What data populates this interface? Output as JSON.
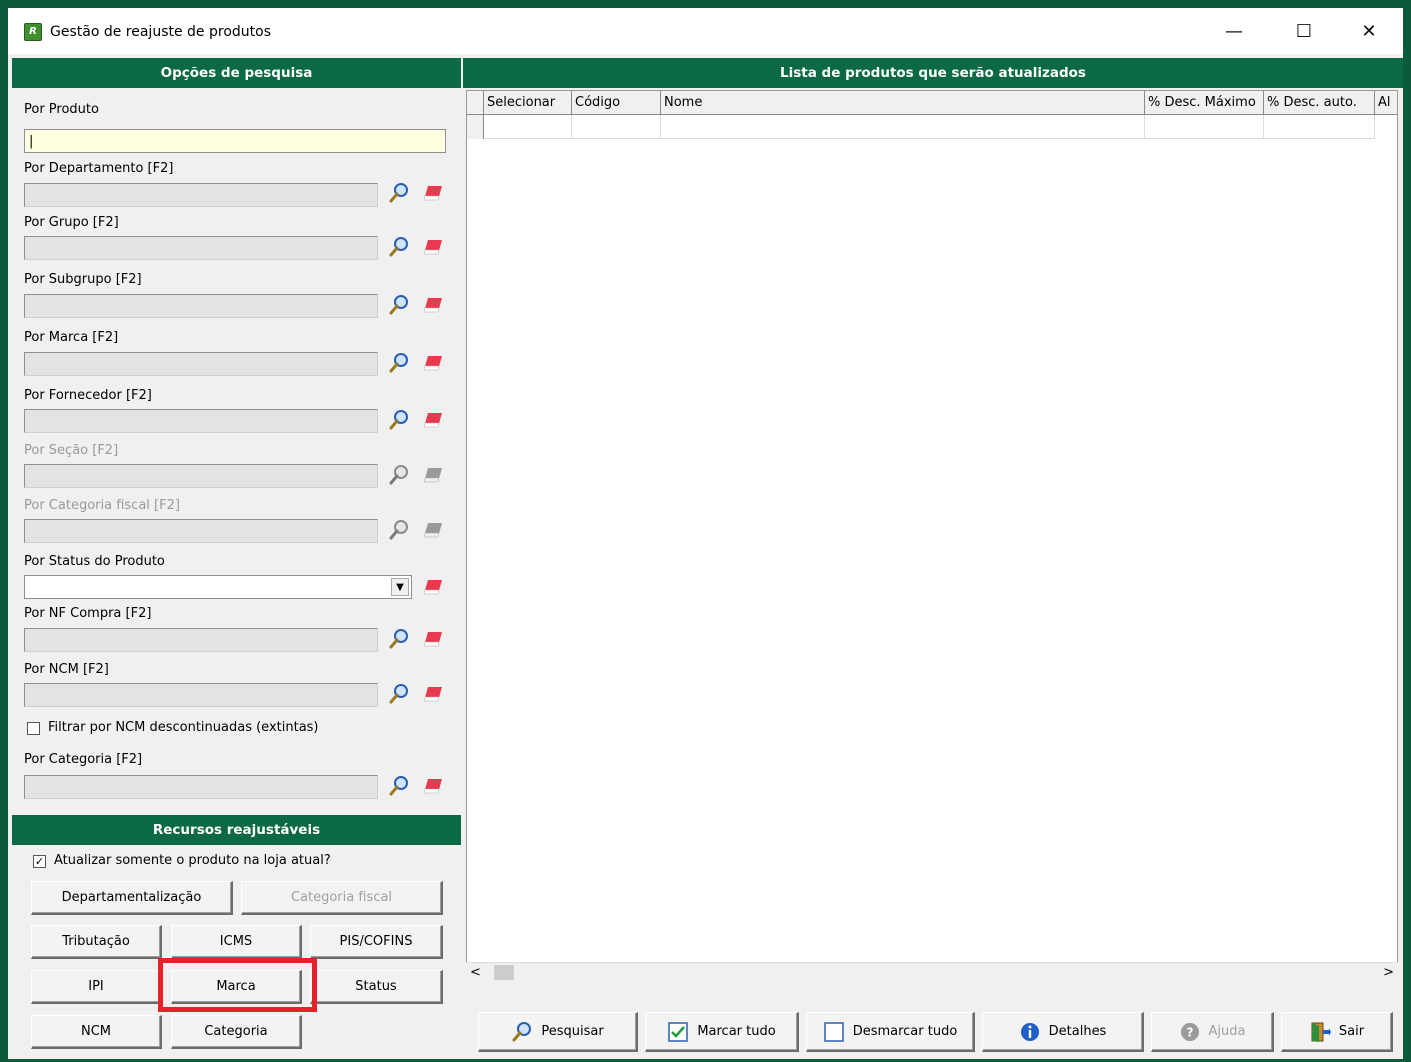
{
  "window": {
    "title": "Gestão de reajuste de produtos",
    "minimize": "—",
    "maximize": "☐",
    "close": "✕"
  },
  "left": {
    "search_header": "Opções de pesquisa",
    "fields": [
      {
        "label": "Por Produto"
      },
      {
        "label": "Por Departamento [F2]"
      },
      {
        "label": "Por Grupo [F2]"
      },
      {
        "label": "Por Subgrupo [F2]"
      },
      {
        "label": "Por Marca [F2]"
      },
      {
        "label": "Por Fornecedor [F2]"
      },
      {
        "label": "Por Seção [F2]",
        "disabled": true
      },
      {
        "label": "Por Categoria fiscal [F2]",
        "disabled": true
      },
      {
        "label": "Por Status do Produto"
      },
      {
        "label": "Por NF Compra [F2]"
      },
      {
        "label": "Por NCM [F2]"
      },
      {
        "label": "Por Categoria [F2]"
      }
    ],
    "ncm_filter_label": "Filtrar por NCM descontinuadas (extintas)",
    "ncm_filter_checked": false,
    "resources_header": "Recursos reajustáveis",
    "store_only_label": "Atualizar somente o produto na loja atual?",
    "store_only_checked": true,
    "buttons": {
      "departamentalizacao": "Departamentalização",
      "categoria_fiscal": "Categoria fiscal",
      "tributacao": "Tributação",
      "icms": "ICMS",
      "pis_cofins": "PIS/COFINS",
      "ipi": "IPI",
      "marca": "Marca",
      "status": "Status",
      "ncm": "NCM",
      "categoria": "Categoria"
    }
  },
  "right": {
    "header": "Lista de produtos que serão atualizados",
    "columns": [
      "Selecionar",
      "Código",
      "Nome",
      "% Desc. Máximo",
      "% Desc. auto.",
      "Al"
    ],
    "actions": {
      "pesquisar": "Pesquisar",
      "marcar_tudo": "Marcar tudo",
      "desmarcar_tudo": "Desmarcar tudo",
      "detalhes": "Detalhes",
      "ajuda": "Ajuda",
      "sair": "Sair"
    }
  },
  "colors": {
    "header_green": "#0b6a45",
    "product_input_bg": "#ffffe1",
    "highlight_red": "#e8202a"
  }
}
